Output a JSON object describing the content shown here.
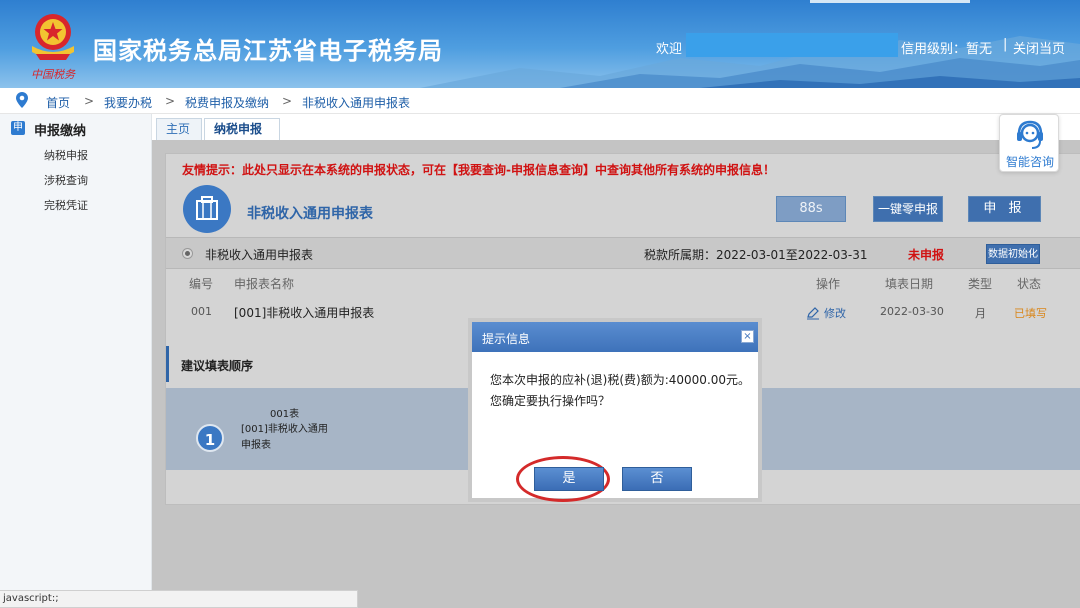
{
  "header": {
    "site_title": "国家税务总局江苏省电子税务局",
    "welcome": "欢迎",
    "credit_level": "信用级别：暂无",
    "separator": "|",
    "close_page": "关闭当页",
    "emblem_text": "中国税务"
  },
  "breadcrumb": {
    "items": [
      "首页",
      "我要办税",
      "税费申报及缴纳",
      "非税收入通用申报表"
    ],
    "arrow": ">"
  },
  "sidebar": {
    "section_icon": "申",
    "section_title": "申报缴纳",
    "items": [
      "纳税申报",
      "涉税查询",
      "完税凭证"
    ]
  },
  "tabs": {
    "home": "主页",
    "active": "纳税申报",
    "close": "×"
  },
  "notice": "友情提示：此处只显示在本系统的申报状态，可在【我要查询-申报信息查询】中查询其他所有系统的申报信息！",
  "form": {
    "title": "非税收入通用申报表",
    "timer": "88s",
    "zero_declare": "一键零申报",
    "declare": "申 报"
  },
  "bar": {
    "name": "非税收入通用申报表",
    "period": "税款所属期：2022-03-01至2022-03-31",
    "status": "未申报",
    "init": "数据初始化"
  },
  "table": {
    "headers": [
      "编号",
      "申报表名称",
      "操作",
      "填表日期",
      "类型",
      "状态"
    ],
    "row": {
      "code": "001",
      "name": "[001]非税收入通用申报表",
      "action": "修改",
      "date": "2022-03-30",
      "type": "月",
      "status": "已填写"
    }
  },
  "suggest": {
    "title": "建议填表顺序",
    "step_number": "1",
    "step_code": "001表",
    "step_name": "[001]非税收入通用申报表"
  },
  "dialog": {
    "title": "提示信息",
    "close": "×",
    "message_line1": "您本次申报的应补(退)税(费)额为:40000.00元。",
    "message_line2": "您确定要执行操作吗？",
    "yes": "是",
    "no": "否"
  },
  "consult": {
    "label": "智能咨询"
  },
  "statusbar": {
    "text": "javascript:;"
  },
  "colors": {
    "accent": "#3f6fae",
    "warning": "#d01212",
    "highlight_ring": "#d42a2a"
  }
}
